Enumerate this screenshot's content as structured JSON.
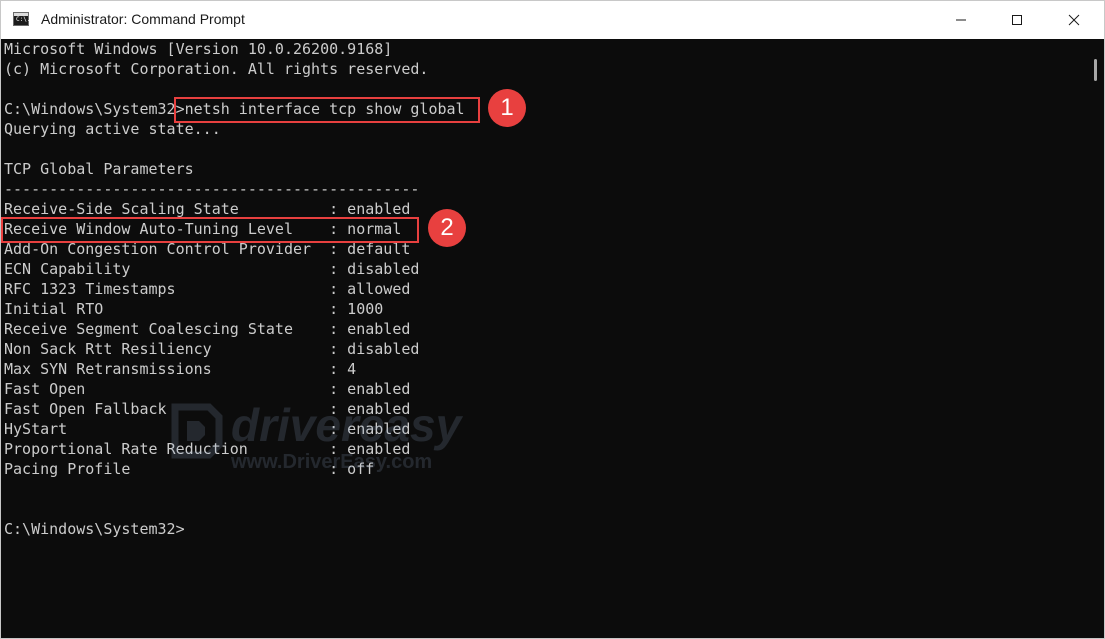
{
  "window": {
    "title": "Administrator: Command Prompt",
    "icon_text": "C:\\.",
    "controls": {
      "minimize": "—",
      "maximize": "☐",
      "close": "✕"
    }
  },
  "console": {
    "lines": [
      "Microsoft Windows [Version 10.0.26200.9168]",
      "(c) Microsoft Corporation. All rights reserved.",
      "",
      "C:\\Windows\\System32>netsh interface tcp show global",
      "Querying active state...",
      "",
      "TCP Global Parameters",
      "----------------------------------------------",
      "Receive-Side Scaling State          : enabled",
      "Receive Window Auto-Tuning Level    : normal",
      "Add-On Congestion Control Provider  : default",
      "ECN Capability                      : disabled",
      "RFC 1323 Timestamps                 : allowed",
      "Initial RTO                         : 1000",
      "Receive Segment Coalescing State    : enabled",
      "Non Sack Rtt Resiliency             : disabled",
      "Max SYN Retransmissions             : 4",
      "Fast Open                           : enabled",
      "Fast Open Fallback                  : enabled",
      "HyStart                             : enabled",
      "Proportional Rate Reduction         : enabled",
      "Pacing Profile                      : off",
      "",
      "",
      "C:\\Windows\\System32>"
    ]
  },
  "annotations": {
    "badge1": "1",
    "badge2": "2",
    "color": "#e8403f"
  },
  "watermark": {
    "brand": "drivereasy",
    "url": "www.DriverEasy.com"
  }
}
